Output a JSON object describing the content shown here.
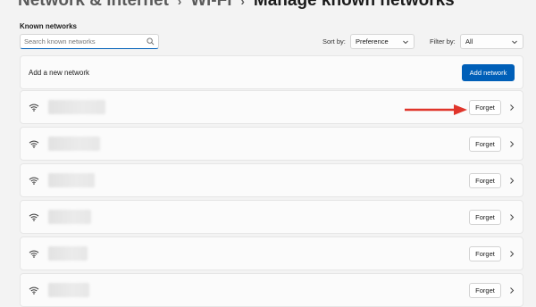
{
  "breadcrumb": {
    "items": [
      "Network & internet",
      "Wi-Fi",
      "Manage known networks"
    ],
    "separator": "›"
  },
  "known_networks": {
    "title": "Known networks",
    "search": {
      "placeholder": "Search known networks",
      "icon": "search-icon"
    },
    "sort": {
      "label": "Sort by:",
      "selected": "Preference"
    },
    "filter": {
      "label": "Filter by:",
      "selected": "All"
    }
  },
  "add_network": {
    "label": "Add a new network",
    "button_label": "Add network"
  },
  "networks": [
    {
      "name": "",
      "forget_label": "Forget"
    },
    {
      "name": "",
      "forget_label": "Forget"
    },
    {
      "name": "",
      "forget_label": "Forget"
    },
    {
      "name": "",
      "forget_label": "Forget"
    },
    {
      "name": "",
      "forget_label": "Forget"
    },
    {
      "name": "",
      "forget_label": "Forget"
    }
  ],
  "colors": {
    "accent": "#005fb8",
    "annotation_arrow": "#e0352b",
    "background": "#f3f3f3",
    "card": "#fbfbfb"
  }
}
